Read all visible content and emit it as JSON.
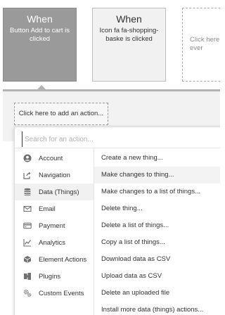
{
  "events": [
    {
      "title": "When",
      "text": "Button Add to cart is clicked"
    },
    {
      "title": "When",
      "text": "Icon fa fa-shopping-baske is clicked"
    },
    {
      "text": "Click here\never"
    }
  ],
  "add_action_label": "Click here to add an action...",
  "search": {
    "placeholder": "Search for an action..."
  },
  "categories": [
    {
      "label": "Account",
      "icon": "user-circle-icon"
    },
    {
      "label": "Navigation",
      "icon": "share-icon"
    },
    {
      "label": "Data (Things)",
      "icon": "database-icon",
      "active": true
    },
    {
      "label": "Email",
      "icon": "envelope-icon"
    },
    {
      "label": "Payment",
      "icon": "credit-card-icon"
    },
    {
      "label": "Analytics",
      "icon": "line-chart-icon"
    },
    {
      "label": "Element Actions",
      "icon": "cube-icon"
    },
    {
      "label": "Plugins",
      "icon": "plug-icon"
    },
    {
      "label": "Custom Events",
      "icon": "cogs-icon"
    }
  ],
  "actions": [
    {
      "label": "Create a new thing..."
    },
    {
      "label": "Make changes to thing...",
      "highlighted": true
    },
    {
      "label": "Make changes to a list of things..."
    },
    {
      "label": "Delete thing..."
    },
    {
      "label": "Delete a list of things..."
    },
    {
      "label": "Copy a list of things..."
    },
    {
      "label": "Download data as CSV"
    },
    {
      "label": "Upload data as CSV"
    },
    {
      "label": "Delete an uploaded file"
    },
    {
      "label": "Install more data (things) actions..."
    }
  ],
  "colors": {
    "selected_event_bg": "#9a9a9a",
    "event_bg": "#f1f1f1",
    "strip_bg": "#f2f2f2",
    "icon_color": "#707070"
  }
}
